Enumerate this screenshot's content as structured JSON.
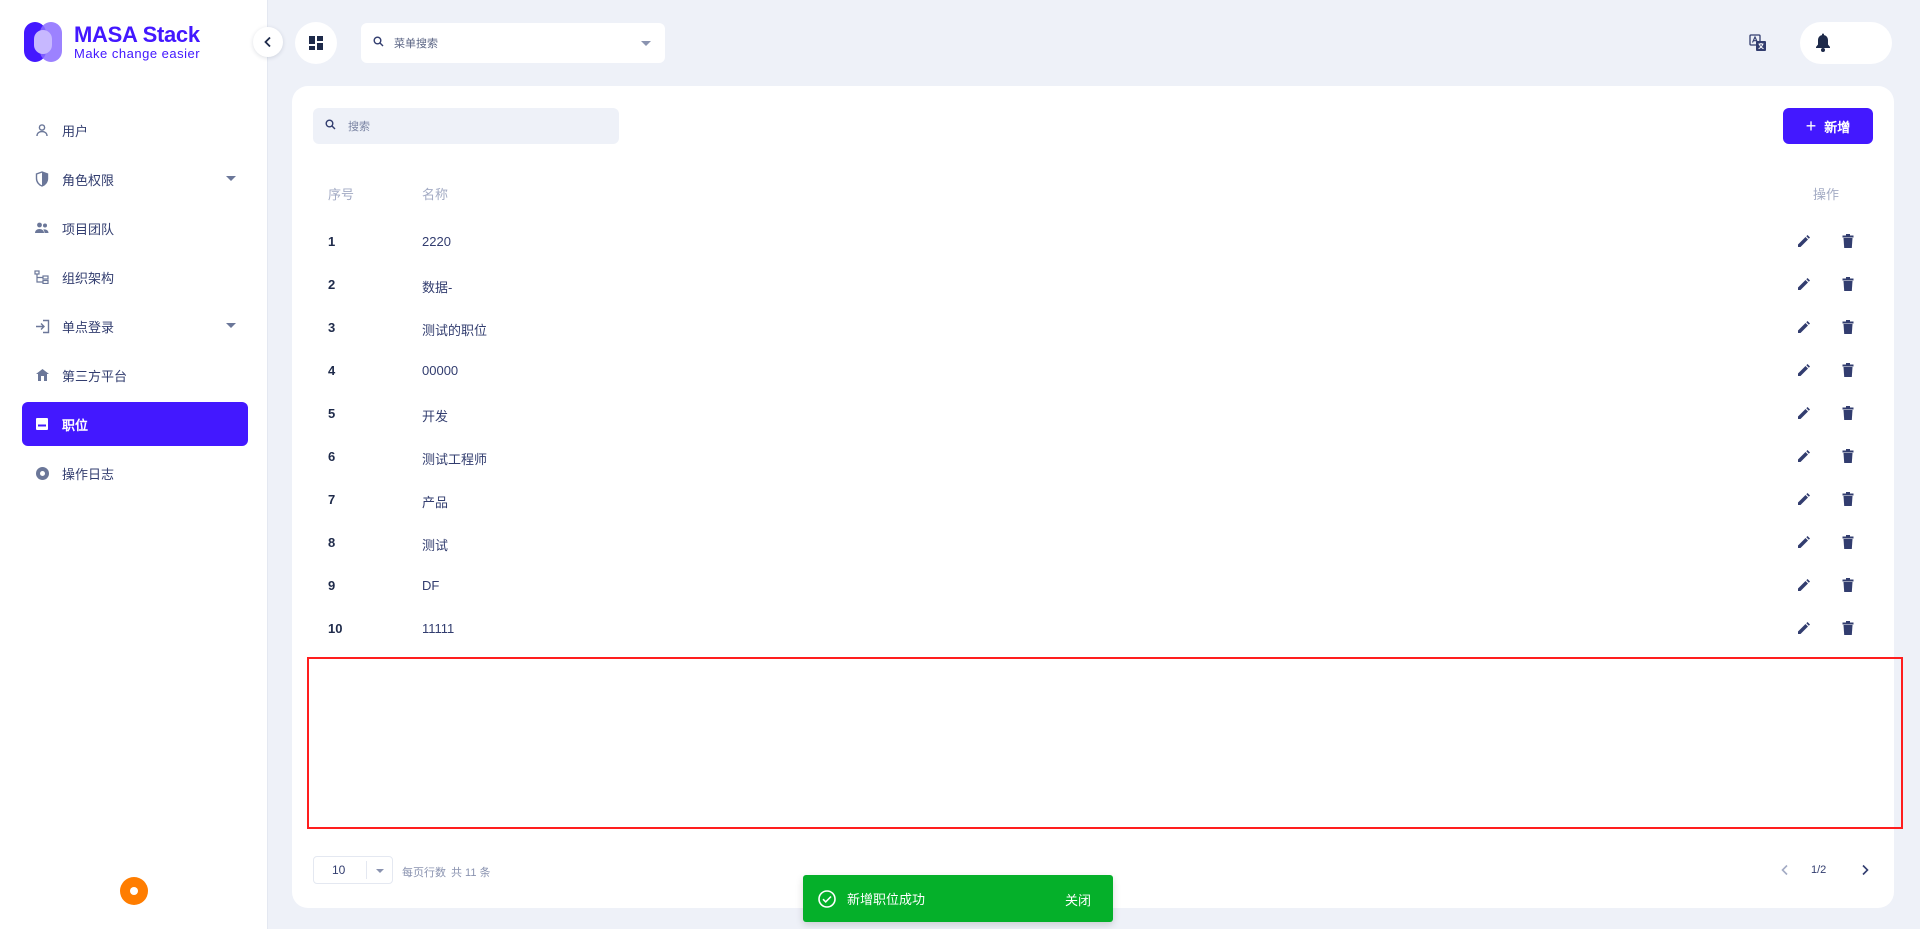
{
  "brand": {
    "name": "MASA Stack",
    "tagline": "Make change easier"
  },
  "colors": {
    "accent": "#4318ff",
    "success": "#05b02a",
    "highlight_border": "#ff1e1e",
    "help": "#ff7d00"
  },
  "sidebar": {
    "items": [
      {
        "label": "用户",
        "icon": "user-icon",
        "expandable": false,
        "active": false
      },
      {
        "label": "角色权限",
        "icon": "shield-icon",
        "expandable": true,
        "active": false
      },
      {
        "label": "项目团队",
        "icon": "team-icon",
        "expandable": false,
        "active": false
      },
      {
        "label": "组织架构",
        "icon": "org-chart-icon",
        "expandable": false,
        "active": false
      },
      {
        "label": "单点登录",
        "icon": "login-icon",
        "expandable": true,
        "active": false
      },
      {
        "label": "第三方平台",
        "icon": "platform-icon",
        "expandable": false,
        "active": false
      },
      {
        "label": "职位",
        "icon": "position-icon",
        "expandable": false,
        "active": true
      },
      {
        "label": "操作日志",
        "icon": "log-icon",
        "expandable": false,
        "active": false
      }
    ]
  },
  "topbar": {
    "menu_search_placeholder": "菜单搜索"
  },
  "main": {
    "search_placeholder": "搜索",
    "add_label": "新增",
    "table": {
      "headers": {
        "index": "序号",
        "name": "名称",
        "actions": "操作"
      },
      "rows": [
        {
          "index": "1",
          "name": "2220"
        },
        {
          "index": "2",
          "name": "数据-"
        },
        {
          "index": "3",
          "name": "测试的职位"
        },
        {
          "index": "4",
          "name": "00000"
        },
        {
          "index": "5",
          "name": "开发"
        },
        {
          "index": "6",
          "name": "测试工程师"
        },
        {
          "index": "7",
          "name": "产品"
        },
        {
          "index": "8",
          "name": "测试"
        },
        {
          "index": "9",
          "name": "DF"
        },
        {
          "index": "10",
          "name": "11111"
        }
      ]
    },
    "pagination": {
      "page_size": "10",
      "rows_per_page_label": "每页行数",
      "total_label": "共 11 条",
      "page_indicator": "1/2"
    }
  },
  "toast": {
    "message": "新增职位成功",
    "close_label": "关闭"
  }
}
